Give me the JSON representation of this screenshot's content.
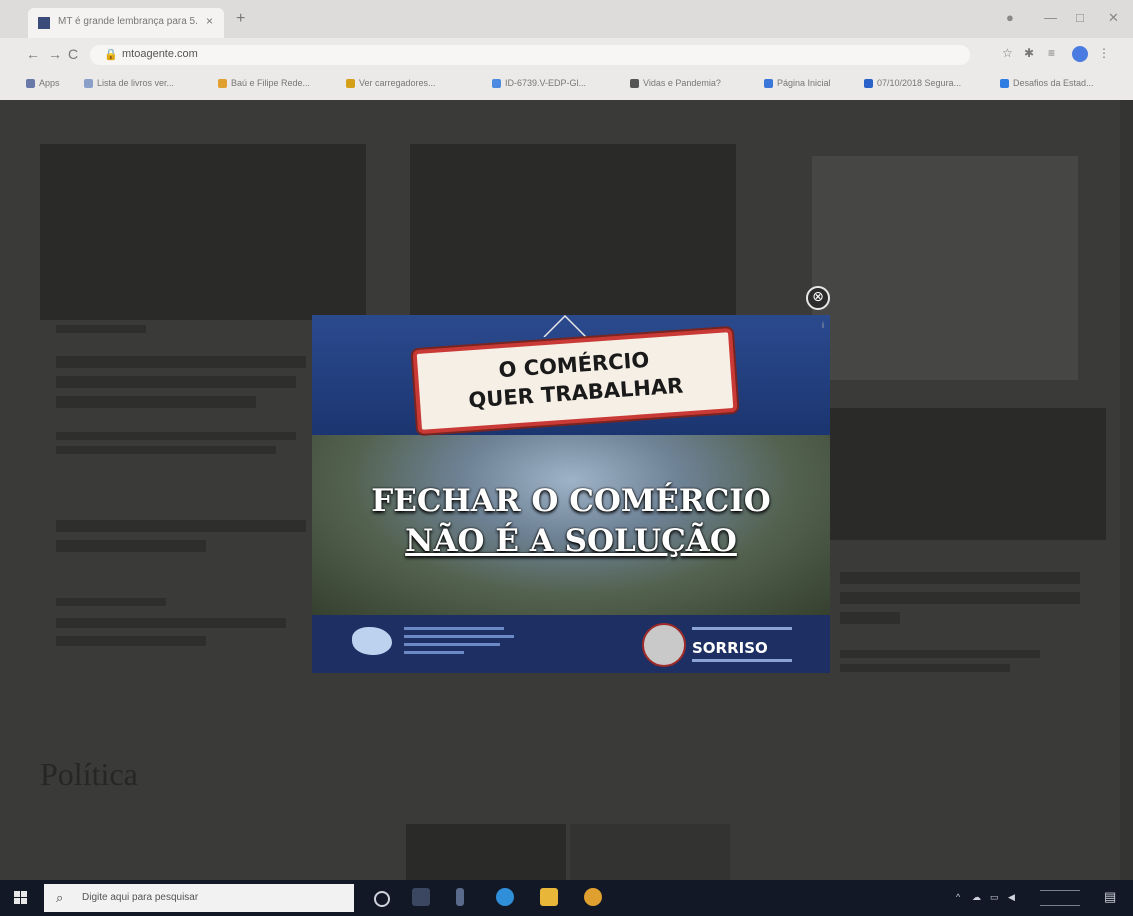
{
  "browser": {
    "tab_title": "MT é grande lembrança para 5...",
    "tab_close": "×",
    "new_tab": "+",
    "url": "mtoagente.com",
    "nav_back": "←",
    "nav_forward": "→",
    "nav_reload": "C",
    "lock": "🔒",
    "win_min": "—",
    "win_max": "□",
    "win_close": "✕",
    "bookmarks": [
      {
        "label": "Apps",
        "color": "#6a7aa8"
      },
      {
        "label": "Lista de livros ver...",
        "color": "#8aa0c8"
      },
      {
        "label": "Baú e Filipe Rede...",
        "color": "#e0a030"
      },
      {
        "label": "Ver carregadores...",
        "color": "#d4a017"
      },
      {
        "label": "ID-6739.V-EDP-Gl...",
        "color": "#4c8be0"
      },
      {
        "label": "Vidas e Pandemia?",
        "color": "#555555"
      },
      {
        "label": "Página Inicial",
        "color": "#3b77d9"
      },
      {
        "label": "07/10/2018 Segura...",
        "color": "#2a62c9"
      },
      {
        "label": "Desafios da Estad...",
        "color": "#2f7de2"
      }
    ]
  },
  "page": {
    "section_heading": "Política"
  },
  "modal": {
    "sign_line1": "O COMÉRCIO",
    "sign_line2": "QUER TRABALHAR",
    "headline_line1": "FECHAR O COMÉRCIO",
    "headline_line2": "NÃO É A SOLUÇÃO",
    "brand": "SORRISO",
    "close_glyph": "⊗",
    "info_glyph": "i"
  },
  "taskbar": {
    "search_placeholder": "Digite aqui para pesquisar",
    "search_glyph": "⌕",
    "tray_chevron": "^"
  }
}
